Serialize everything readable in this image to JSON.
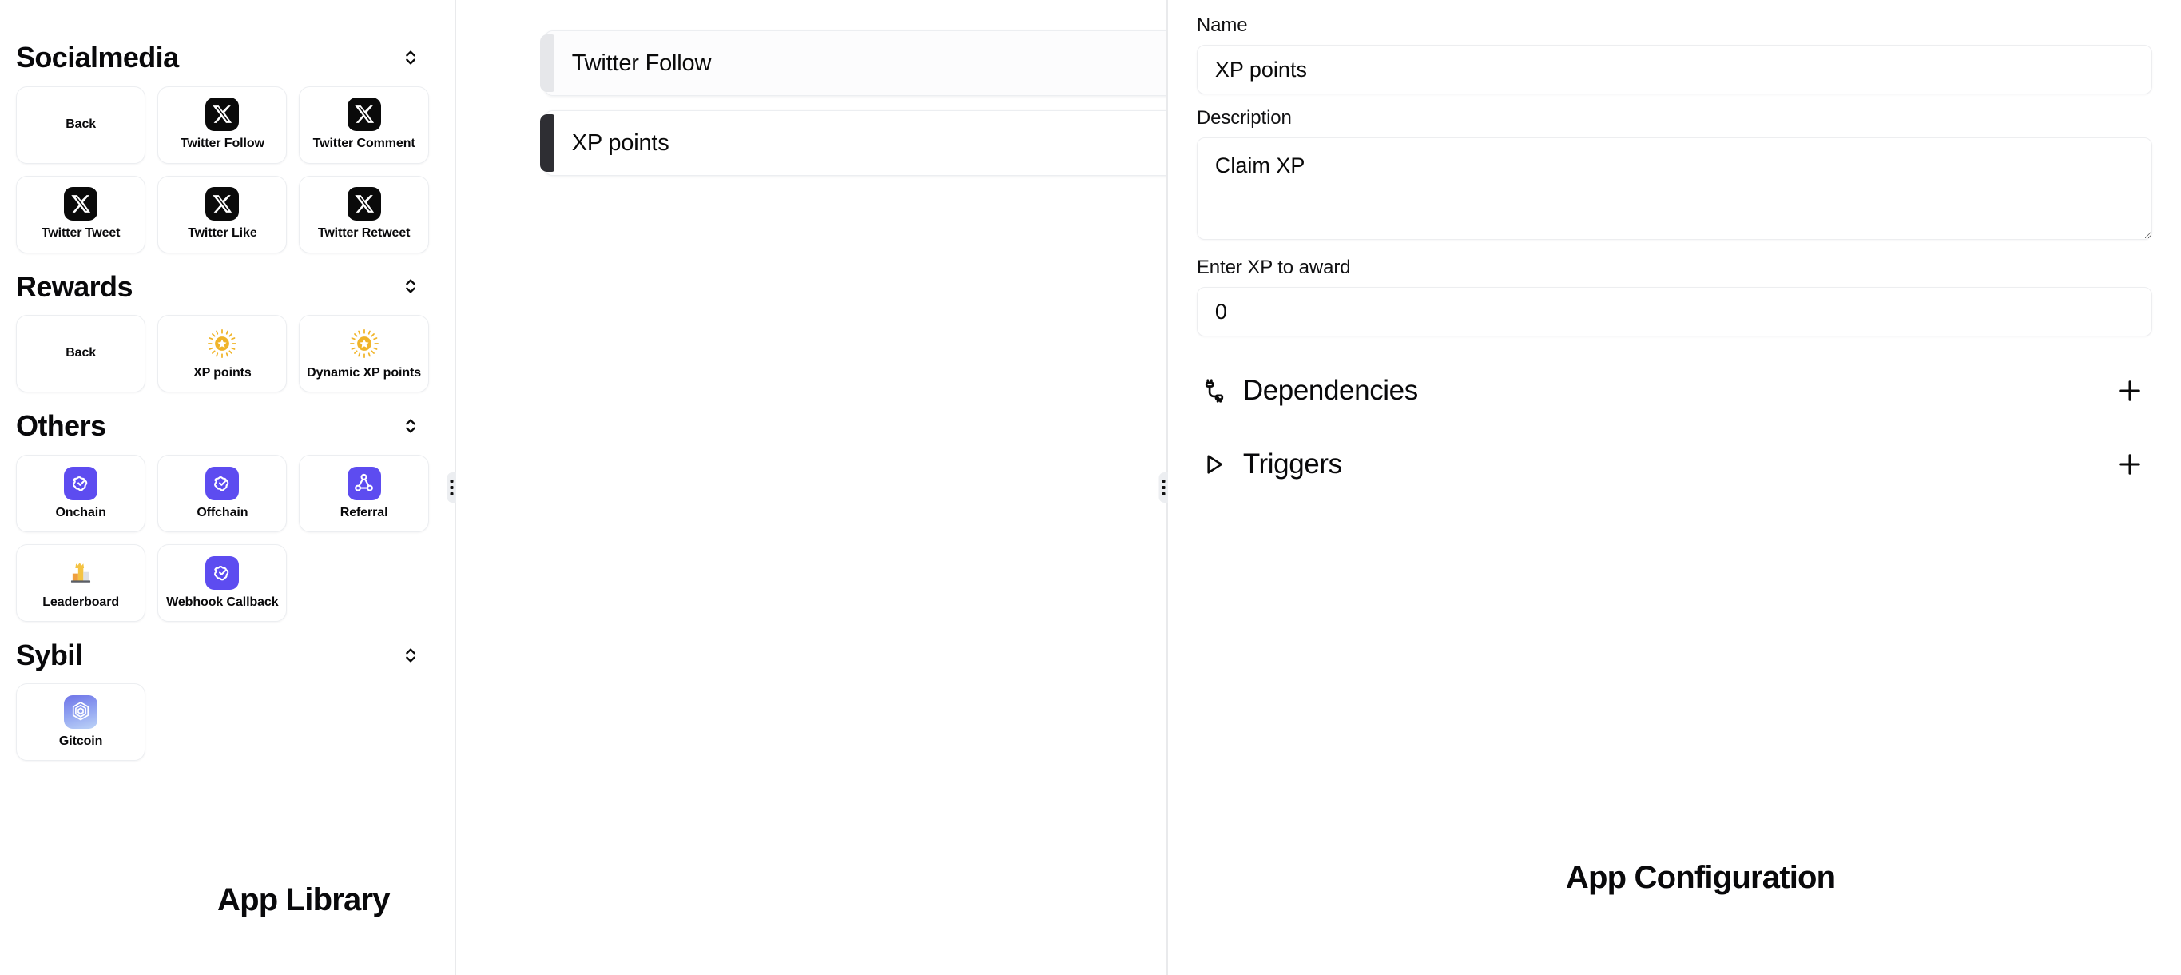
{
  "library": {
    "caption": "App Library",
    "collapse_icon": "chevrons-up-down-icon",
    "sections": [
      {
        "title": "Socialmedia",
        "items": [
          {
            "label": "Back",
            "icon": "none"
          },
          {
            "label": "Twitter Follow",
            "icon": "x-logo-icon"
          },
          {
            "label": "Twitter Comment",
            "icon": "x-logo-icon"
          },
          {
            "label": "Twitter Tweet",
            "icon": "x-logo-icon"
          },
          {
            "label": "Twitter Like",
            "icon": "x-logo-icon"
          },
          {
            "label": "Twitter Retweet",
            "icon": "x-logo-icon"
          }
        ]
      },
      {
        "title": "Rewards",
        "items": [
          {
            "label": "Back",
            "icon": "none"
          },
          {
            "label": "XP points",
            "icon": "sparkle-star-icon"
          },
          {
            "label": "Dynamic XP points",
            "icon": "sparkle-star-icon"
          }
        ]
      },
      {
        "title": "Others",
        "items": [
          {
            "label": "Onchain",
            "icon": "badge-check-icon"
          },
          {
            "label": "Offchain",
            "icon": "badge-check-icon"
          },
          {
            "label": "Referral",
            "icon": "share-network-icon"
          },
          {
            "label": "Leaderboard",
            "icon": "podium-crown-icon"
          },
          {
            "label": "Webhook Callback",
            "icon": "badge-check-icon"
          }
        ]
      },
      {
        "title": "Sybil",
        "items": [
          {
            "label": "Gitcoin",
            "icon": "gitcoin-passport-icon"
          }
        ]
      }
    ]
  },
  "flow": {
    "tasks": [
      {
        "name": "Twitter Follow",
        "selected": false,
        "remove_icon": "close-icon"
      },
      {
        "name": "XP points",
        "selected": true,
        "remove_icon": "close-icon"
      }
    ]
  },
  "config": {
    "caption": "App Configuration",
    "name_label": "Name",
    "name_value": "XP points",
    "name_placeholder": "Name",
    "description_label": "Description",
    "description_value": "Claim XP",
    "description_placeholder": "Description",
    "xp_label": "Enter XP to award",
    "xp_value": "0",
    "xp_placeholder": "0",
    "rows": [
      {
        "title": "Dependencies",
        "icon": "unplug-cable-icon",
        "action_icon": "plus-icon"
      },
      {
        "title": "Triggers",
        "icon": "play-triangle-icon",
        "action_icon": "plus-icon"
      }
    ]
  },
  "colors": {
    "accent_indigo": "#5d4cf0",
    "accent_amber": "#f0b429",
    "selected_bar": "#2e2e33",
    "border": "#eceef1",
    "divider": "#e9eaec"
  }
}
